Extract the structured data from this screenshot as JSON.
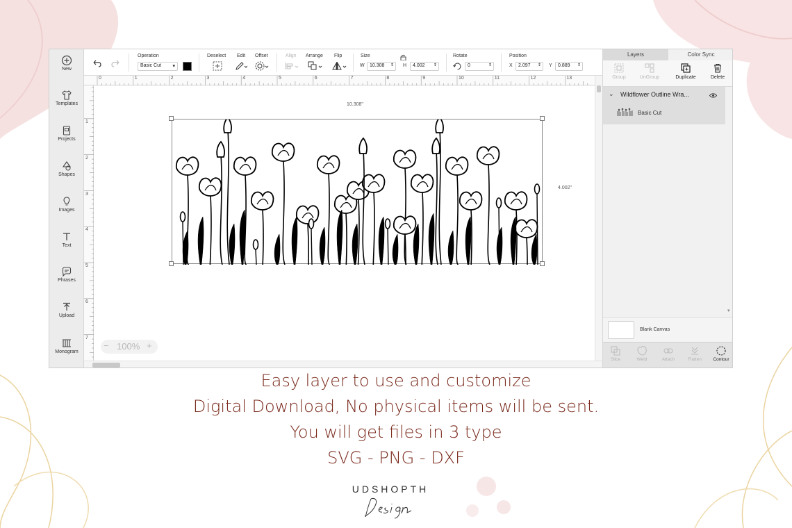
{
  "rail": {
    "items": [
      {
        "label": "New",
        "icon": "plus-circle-icon"
      },
      {
        "label": "Templates",
        "icon": "shirt-icon"
      },
      {
        "label": "Projects",
        "icon": "folder-icon"
      },
      {
        "label": "Shapes",
        "icon": "shapes-icon"
      },
      {
        "label": "Images",
        "icon": "bulb-icon"
      },
      {
        "label": "Text",
        "icon": "text-t-icon"
      },
      {
        "label": "Phrases",
        "icon": "chat-bubble-icon"
      },
      {
        "label": "Upload",
        "icon": "upload-icon"
      },
      {
        "label": "Monogram",
        "icon": "monogram-icon"
      }
    ]
  },
  "toolbar": {
    "operation_label": "Operation",
    "operation_value": "Basic Cut",
    "operation_color": "#000000",
    "deselect_label": "Deselect",
    "edit_label": "Edit",
    "offset_label": "Offset",
    "align_label": "Align",
    "arrange_label": "Arrange",
    "flip_label": "Flip",
    "size_label": "Size",
    "w_label": "W",
    "w_value": "10.308",
    "h_label": "H",
    "h_value": "4.002",
    "rotate_label": "Rotate",
    "rotate_value": "0",
    "position_label": "Position",
    "x_label": "X",
    "x_value": "2.097",
    "y_label": "Y",
    "y_value": "0.889"
  },
  "ruler": {
    "h_numbers": [
      "0",
      "1",
      "2",
      "3",
      "4",
      "5",
      "6",
      "7",
      "8",
      "9",
      "10",
      "11",
      "12",
      "13"
    ],
    "v_numbers": [
      "1",
      "2",
      "3",
      "4",
      "5",
      "6",
      "7"
    ]
  },
  "canvas": {
    "width_label": "10.308\"",
    "height_label": "4.002\"",
    "zoom_value": "100%",
    "zoom_minus": "−",
    "zoom_plus": "+"
  },
  "panel": {
    "tabs": [
      "Layers",
      "Color Sync"
    ],
    "tools": [
      {
        "label": "Group",
        "icon": "group-icon",
        "enabled": false
      },
      {
        "label": "UnGroup",
        "icon": "ungroup-icon",
        "enabled": false
      },
      {
        "label": "Duplicate",
        "icon": "duplicate-icon",
        "enabled": true
      },
      {
        "label": "Delete",
        "icon": "trash-icon",
        "enabled": true
      }
    ],
    "layer_title": "Wildflower Outline Wra...",
    "layer_sub": "Basic Cut",
    "blank_canvas": "Blank Canvas",
    "bottom_tools": [
      {
        "label": "Slice",
        "icon": "slice-icon",
        "enabled": false
      },
      {
        "label": "Weld",
        "icon": "weld-icon",
        "enabled": false
      },
      {
        "label": "Attach",
        "icon": "attach-icon",
        "enabled": false
      },
      {
        "label": "Flatten",
        "icon": "flatten-icon",
        "enabled": false
      },
      {
        "label": "Contour",
        "icon": "contour-icon",
        "enabled": true
      }
    ]
  },
  "caption": {
    "line1": "Easy layer to use and customize",
    "line2": "Digital Download, No physical items will be sent.",
    "line3": "You will get files in 3 type",
    "line4": "SVG - PNG - DXF"
  },
  "brand": {
    "name": "UDSHOPTH",
    "script": "Design"
  },
  "colors": {
    "caption": "#7a2a1c",
    "decor_pink": "#f3d6d6",
    "decor_gold": "#e9cf9d"
  }
}
